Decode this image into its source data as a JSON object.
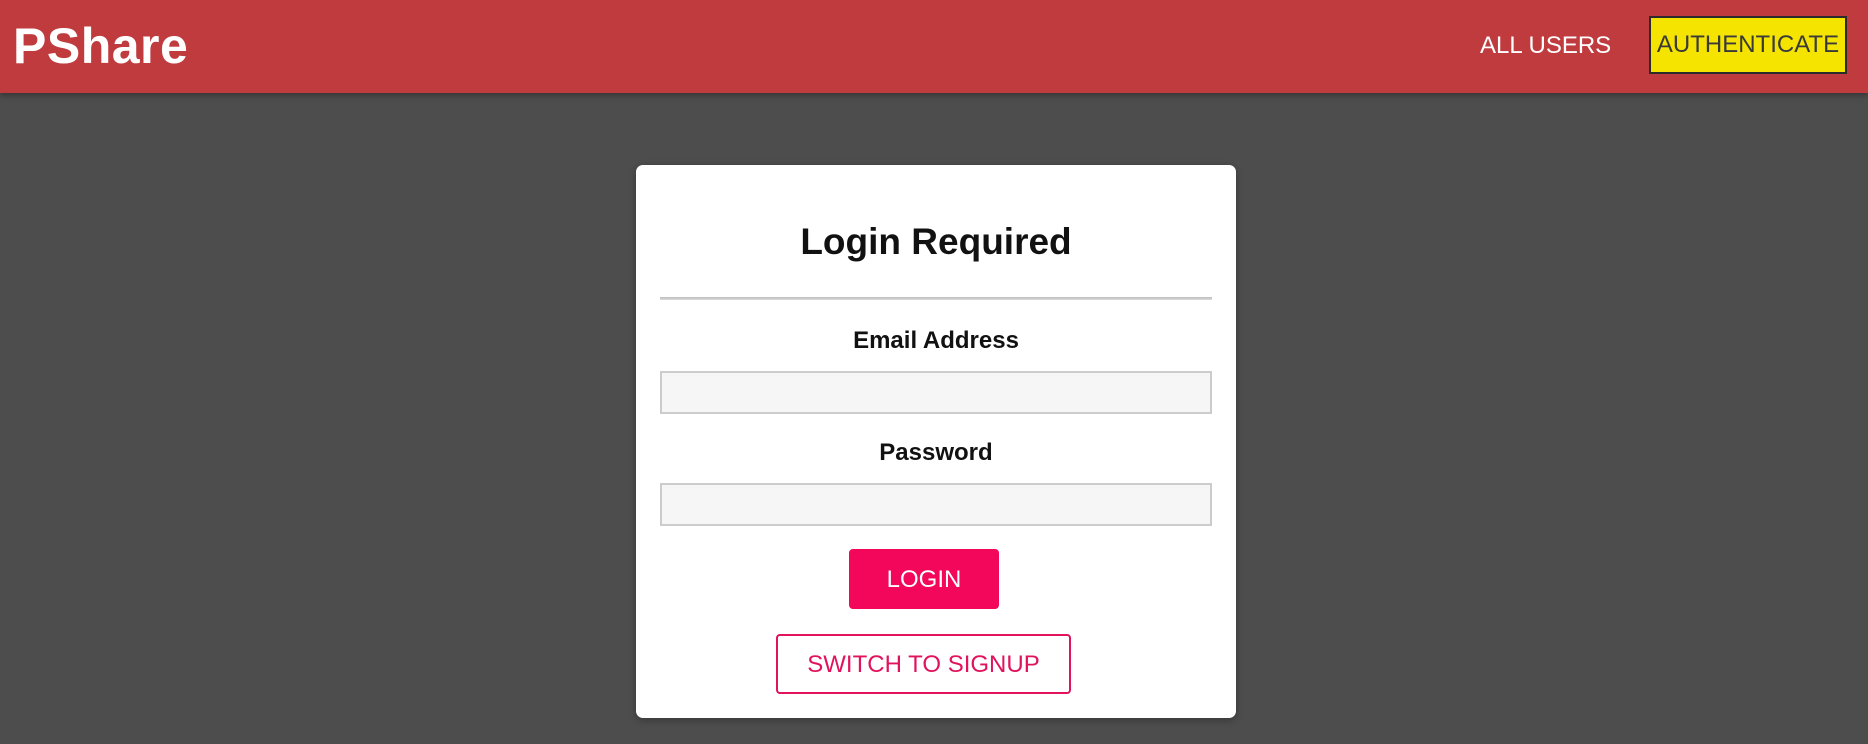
{
  "header": {
    "brand": "PShare",
    "nav": {
      "all_users": "ALL USERS",
      "authenticate": "AUTHENTICATE"
    }
  },
  "auth_card": {
    "title": "Login Required",
    "email": {
      "label": "Email Address",
      "value": ""
    },
    "password": {
      "label": "Password",
      "value": ""
    },
    "login_label": "LOGIN",
    "switch_label": "SWITCH TO SIGNUP"
  },
  "colors": {
    "header_bg": "#c03b3e",
    "page_bg": "#4d4d4d",
    "auth_button_bg": "#f5e400",
    "accent": "#f2075a"
  }
}
